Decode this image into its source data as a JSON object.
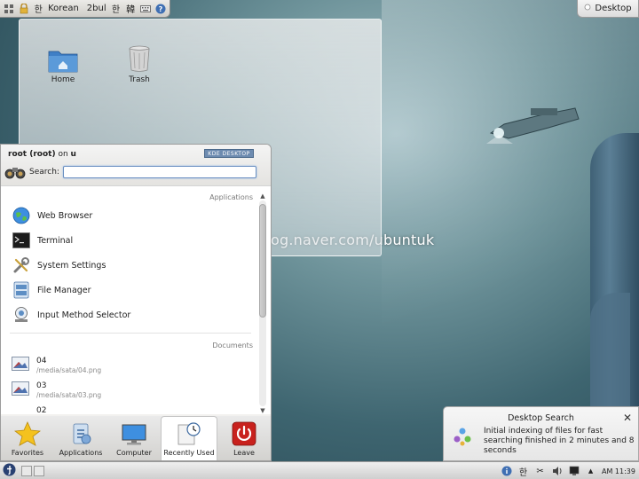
{
  "input_panel": {
    "language_label": "Korean",
    "keyboard_label": "2bul",
    "hangul_glyph": "한",
    "hanja_glyph": "韓",
    "help_glyph": "?"
  },
  "desktop_button": {
    "label": "Desktop"
  },
  "desktop_icons": [
    {
      "label": "Home"
    },
    {
      "label": "Trash"
    }
  ],
  "watermark": "blog.naver.com/ubuntuk",
  "kickoff": {
    "user": "root (root)",
    "on_label": "on",
    "host": "u",
    "badge": "KDE DESKTOP",
    "search_label": "Search:",
    "search_value": "",
    "applications_header": "Applications",
    "applications": [
      {
        "label": "Web Browser",
        "icon": "globe-icon"
      },
      {
        "label": "Terminal",
        "icon": "terminal-icon"
      },
      {
        "label": "System Settings",
        "icon": "tools-icon"
      },
      {
        "label": "File Manager",
        "icon": "file-manager-icon"
      },
      {
        "label": "Input Method Selector",
        "icon": "input-method-icon"
      }
    ],
    "documents_header": "Documents",
    "documents": [
      {
        "title": "04",
        "path": "/media/sata/04.png"
      },
      {
        "title": "03",
        "path": "/media/sata/03.png"
      },
      {
        "title": "02",
        "path": ""
      }
    ],
    "tabs": [
      {
        "label": "Favorites",
        "icon": "star-icon"
      },
      {
        "label": "Applications",
        "icon": "applications-icon"
      },
      {
        "label": "Computer",
        "icon": "computer-icon"
      },
      {
        "label": "Recently Used",
        "icon": "recently-used-icon",
        "active": true
      },
      {
        "label": "Leave",
        "icon": "power-icon"
      }
    ]
  },
  "notification": {
    "title": "Desktop Search",
    "body": "Initial indexing of files for fast searching finished in 2 minutes and 8 seconds",
    "close_glyph": "✕"
  },
  "panel": {
    "clock": "AM 11:39",
    "hangul_glyph": "한"
  },
  "colors": {
    "accent": "#6a8fc1",
    "leave_red": "#c8211d"
  }
}
